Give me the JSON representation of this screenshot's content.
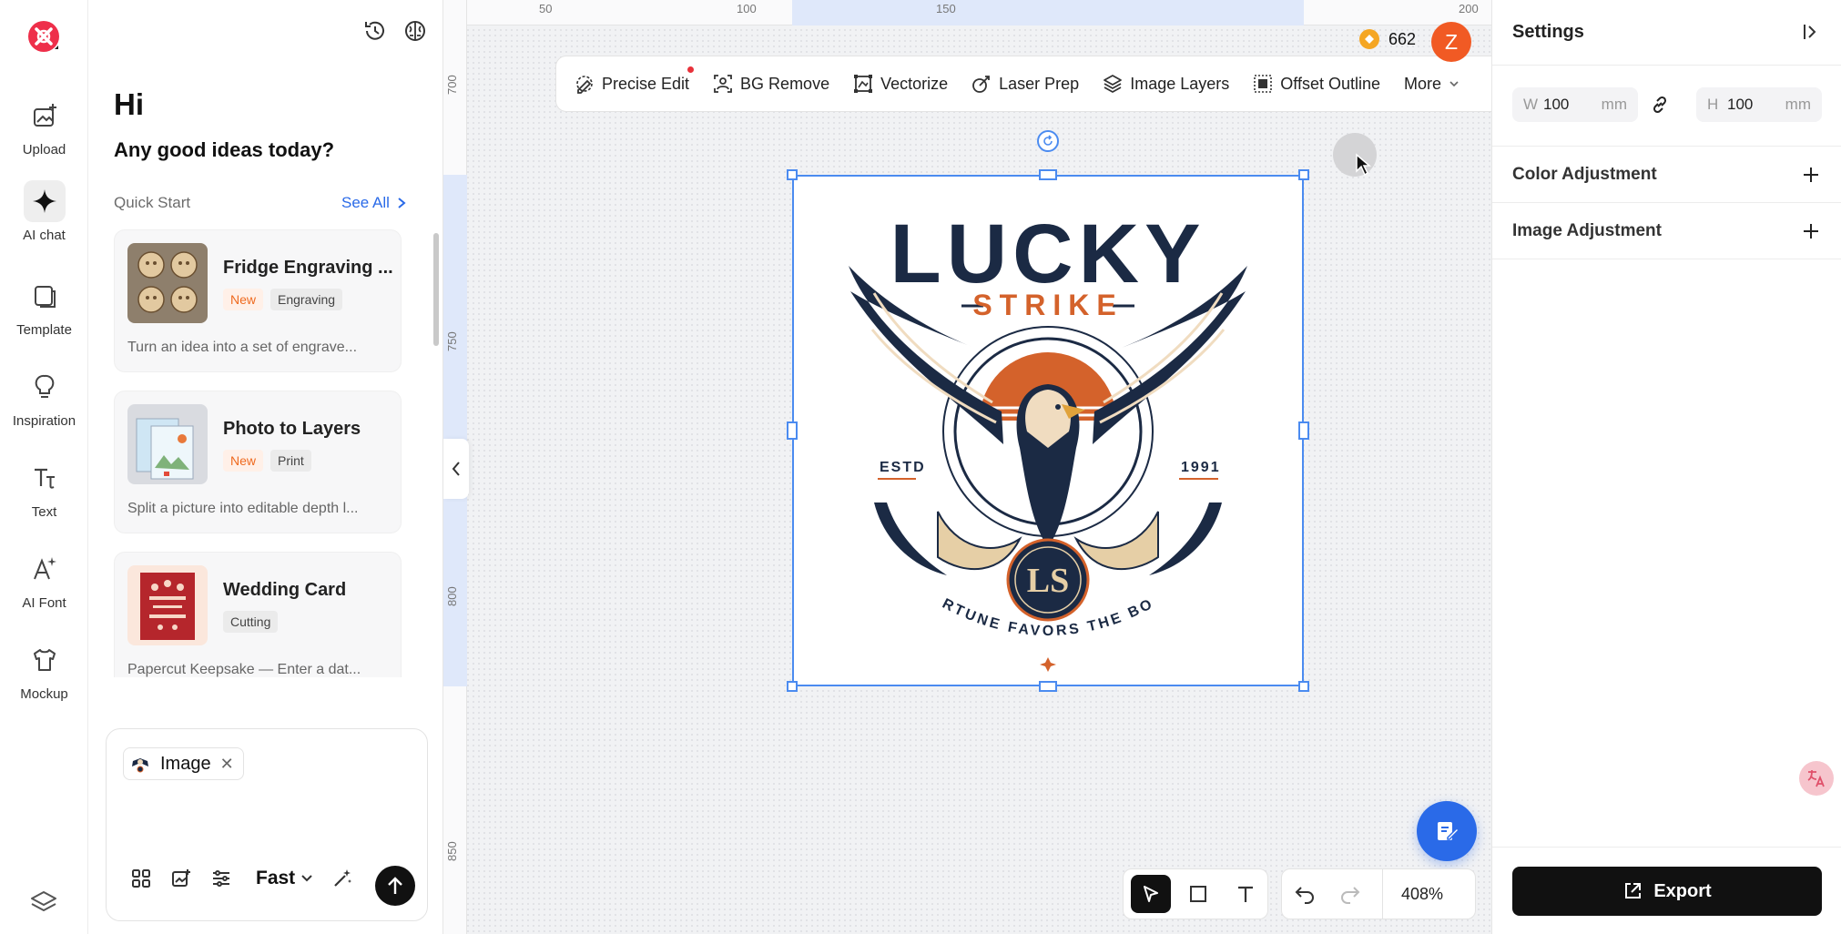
{
  "rail": {
    "items": [
      {
        "label": "Upload",
        "icon": "upload-image-icon"
      },
      {
        "label": "AI chat",
        "icon": "sparkle-icon"
      },
      {
        "label": "Template",
        "icon": "template-icon"
      },
      {
        "label": "Inspiration",
        "icon": "lightbulb-icon"
      },
      {
        "label": "Text",
        "icon": "text-icon"
      },
      {
        "label": "AI Font",
        "icon": "ai-font-icon"
      },
      {
        "label": "Mockup",
        "icon": "tshirt-icon"
      }
    ]
  },
  "chat": {
    "greeting": "Hi",
    "subtitle": "Any good ideas today?",
    "quick_start": "Quick Start",
    "see_all": "See All",
    "cards": [
      {
        "title": "Fridge Engraving ...",
        "tags": [
          "New",
          "Engraving"
        ],
        "desc": "Turn an idea into a set of engrave..."
      },
      {
        "title": "Photo to Layers",
        "tags": [
          "New",
          "Print"
        ],
        "desc": "Split a picture into editable depth l..."
      },
      {
        "title": "Wedding Card",
        "tags": [
          "Cutting"
        ],
        "desc": "Papercut Keepsake — Enter a dat..."
      }
    ],
    "composer": {
      "chip_label": "Image",
      "mode": "Fast"
    }
  },
  "ruler": {
    "top": [
      "50",
      "100",
      "150",
      "200"
    ],
    "left": [
      "700",
      "750",
      "800",
      "850"
    ]
  },
  "toolbar": {
    "items": [
      {
        "label": "Precise Edit",
        "icon": "precise-edit-icon"
      },
      {
        "label": "BG Remove",
        "icon": "bg-remove-icon"
      },
      {
        "label": "Vectorize",
        "icon": "vectorize-icon"
      },
      {
        "label": "Laser Prep",
        "icon": "laser-prep-icon"
      },
      {
        "label": "Image Layers",
        "icon": "layers-icon"
      },
      {
        "label": "Offset Outline",
        "icon": "offset-outline-icon"
      }
    ],
    "more": "More"
  },
  "credits": "662",
  "avatar_initial": "Z",
  "logo_text": {
    "top": "LUCKY",
    "middle": "STRIKE",
    "left": "ESTD",
    "right": "1991",
    "monogram": "LS",
    "bottom": "FORTUNE FAVORS THE BOLD"
  },
  "zoom": "408%",
  "settings": {
    "title": "Settings",
    "width": {
      "label": "W",
      "value": "100",
      "unit": "mm"
    },
    "height": {
      "label": "H",
      "value": "100",
      "unit": "mm"
    },
    "sections": [
      "Color Adjustment",
      "Image Adjustment"
    ],
    "export_label": "Export"
  },
  "colors": {
    "accent_blue": "#2a6ae8",
    "selection": "#4b8bf0",
    "avatar": "#f15a24",
    "navy": "#1b2a44",
    "orange": "#d4622b"
  }
}
